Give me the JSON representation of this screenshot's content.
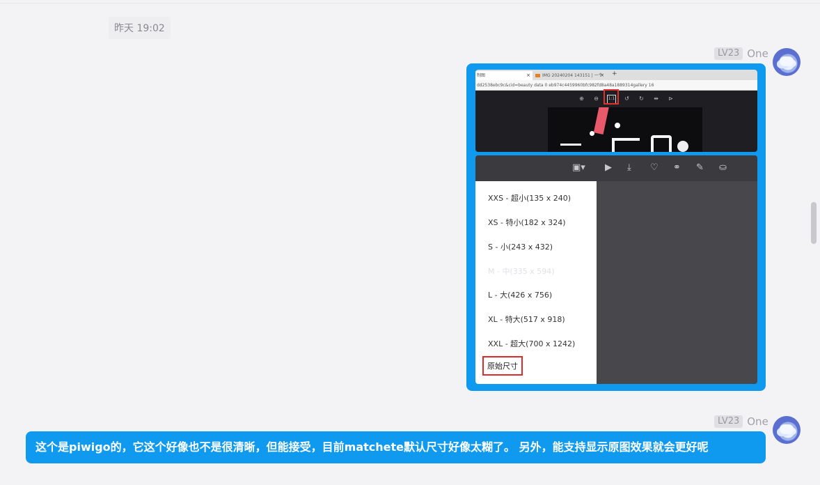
{
  "timestamp": "昨天 19:02",
  "message1": {
    "level": "LV23",
    "user": "One",
    "screenshot": {
      "tab1_title": "制图",
      "tab2_title": "IMG 20240204 143151 | 一个生",
      "url": "dd2538ebc9c&cid=beauty data 0 eb974c4459960bfc982fd8a48a1889314gallery 16",
      "zoom_tool_label": "1:1",
      "size_menu": [
        "XXS - 超小(135 x 240)",
        "XS - 特小(182 x 324)",
        "S - 小(243 x 432)",
        "M - 中(335 x 594)",
        "L - 大(426 x 756)",
        "XL - 特大(517 x 918)",
        "XXL - 超大(700 x 1242)",
        "原始尺寸"
      ]
    }
  },
  "message2": {
    "level": "LV23",
    "user": "One",
    "text": "这个是piwigo的，它这个好像也不是很清晰，但能接受，目前matchete默认尺寸好像太糊了。 另外，能支持显示原图效果就会更好呢"
  },
  "icons": {
    "toolbar": [
      "image-size-icon",
      "play-icon",
      "download-icon",
      "heart-icon",
      "link-icon",
      "edit-icon",
      "basket-icon"
    ]
  },
  "colors": {
    "bubble": "#0f9aef",
    "highlight": "#e02a2a"
  }
}
